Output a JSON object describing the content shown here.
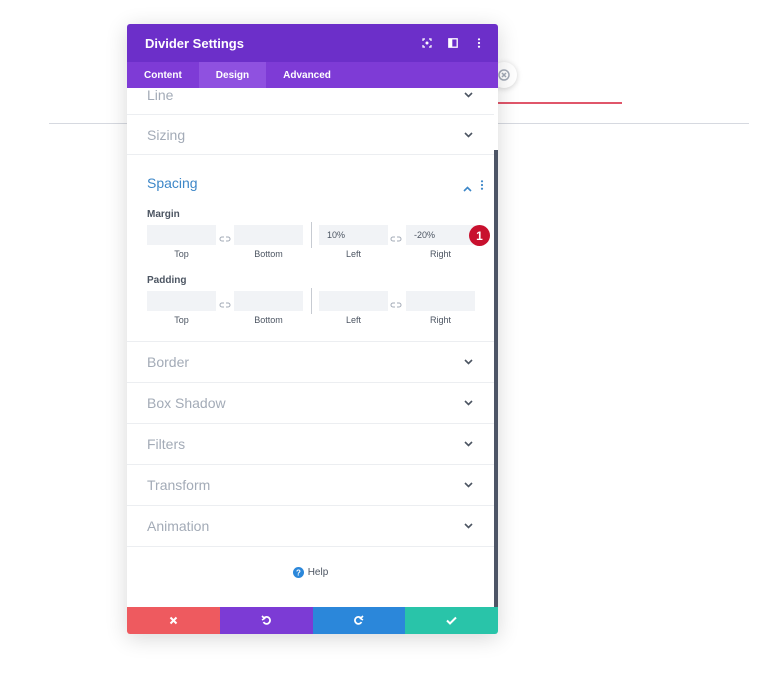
{
  "modal": {
    "title": "Divider Settings",
    "tabs": [
      {
        "label": "Content",
        "active": false
      },
      {
        "label": "Design",
        "active": true
      },
      {
        "label": "Advanced",
        "active": false
      }
    ],
    "header_icons": [
      "focus-icon",
      "layout-toggle-icon",
      "more-vertical-icon"
    ]
  },
  "sections": {
    "line": "Line",
    "sizing": "Sizing",
    "spacing": "Spacing",
    "border": "Border",
    "box_shadow": "Box Shadow",
    "filters": "Filters",
    "transform": "Transform",
    "animation": "Animation"
  },
  "spacing": {
    "margin": {
      "label": "Margin",
      "top": "",
      "bottom": "",
      "left": "10%",
      "right": "-20%"
    },
    "padding": {
      "label": "Padding",
      "top": "",
      "bottom": "",
      "left": "",
      "right": ""
    },
    "captions": {
      "top": "Top",
      "bottom": "Bottom",
      "left": "Left",
      "right": "Right"
    }
  },
  "marker": "1",
  "help": {
    "label": "Help"
  },
  "footer": {
    "buttons": [
      {
        "name": "cancel",
        "color": "#ee5a5f"
      },
      {
        "name": "undo",
        "color": "#7c3bd5"
      },
      {
        "name": "redo",
        "color": "#2b87da"
      },
      {
        "name": "save",
        "color": "#29c4a9"
      }
    ]
  },
  "colors": {
    "header": "#6c2fc9",
    "tabs": "#7e3bd6",
    "active_tab": "#8f51e0",
    "accent_blue": "#3d87c8",
    "marker": "#c8102e"
  }
}
